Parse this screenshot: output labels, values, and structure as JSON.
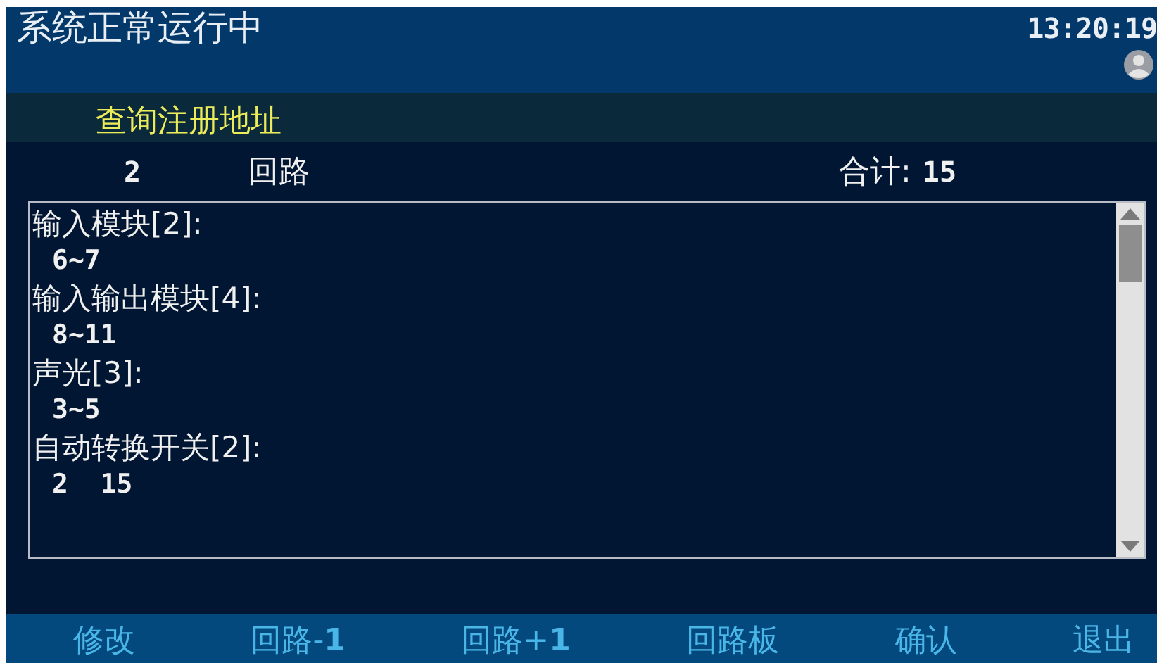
{
  "header": {
    "title": "系统正常运行中",
    "time": "13:20:19"
  },
  "subtitle": "查询注册地址",
  "loop": {
    "number": "2",
    "label": "回路",
    "total_label": "合计:",
    "total": "15"
  },
  "entries": [
    {
      "name": "输入模块[2]:",
      "addresses": "6~7"
    },
    {
      "name": "输入输出模块[4]:",
      "addresses": "8~11"
    },
    {
      "name": "声光[3]:",
      "addresses": "3~5"
    },
    {
      "name": "自动转换开关[2]:",
      "addresses": "2  15"
    }
  ],
  "softkeys": [
    "修改",
    "回路-**1**",
    "回路+**1**",
    "回路板",
    "确认",
    "退出"
  ]
}
